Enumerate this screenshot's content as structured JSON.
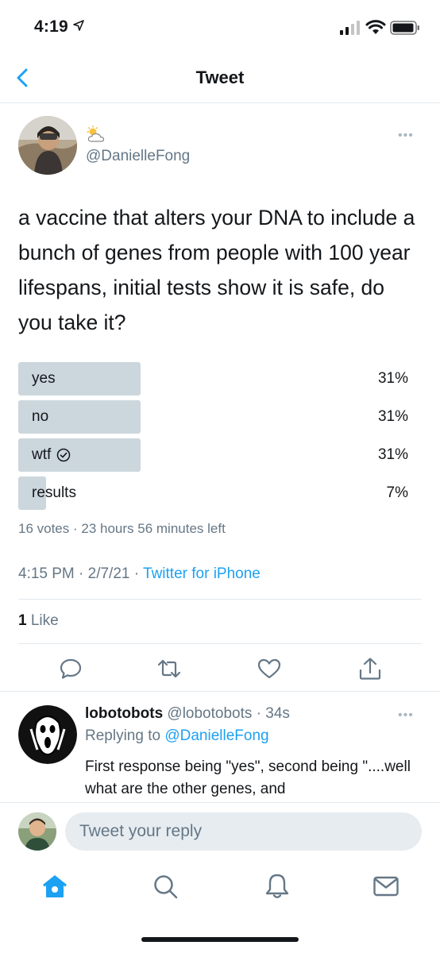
{
  "status_bar": {
    "time": "4:19"
  },
  "nav": {
    "title": "Tweet"
  },
  "tweet": {
    "handle": "@DanielleFong",
    "text": "a vaccine that alters your DNA to include a bunch of genes from people with 100 year lifespans, initial tests show it is safe, do you take it?",
    "poll": {
      "options": [
        {
          "label": "yes",
          "percent": "31%",
          "share": 0.31,
          "selected": false
        },
        {
          "label": "no",
          "percent": "31%",
          "share": 0.31,
          "selected": false
        },
        {
          "label": "wtf",
          "percent": "31%",
          "share": 0.31,
          "selected": true
        },
        {
          "label": "results",
          "percent": "7%",
          "share": 0.07,
          "selected": false
        }
      ],
      "meta": "16 votes · 23 hours 56 minutes left"
    },
    "timestamp": "4:15 PM · 2/7/21 · ",
    "source": "Twitter for iPhone",
    "likes_count": "1",
    "likes_label": " Like"
  },
  "reply": {
    "name": "lobotobots",
    "handle_time": " @lobotobots · 34s",
    "replying_prefix": "Replying to ",
    "replying_to": "@DanielleFong",
    "text": "First response being \"yes\", second being \"....well what are the other genes, and"
  },
  "compose": {
    "placeholder": "Tweet your reply"
  },
  "colors": {
    "accent": "#1da1f2",
    "poll_fill": "#ccd6dd",
    "muted": "#657786"
  },
  "icons": [
    "back-chevron-icon",
    "weather-icon",
    "more-icon",
    "check-circle-icon",
    "reply-icon",
    "retweet-icon",
    "like-icon",
    "share-icon",
    "home-icon",
    "search-icon",
    "notifications-icon",
    "messages-icon"
  ]
}
